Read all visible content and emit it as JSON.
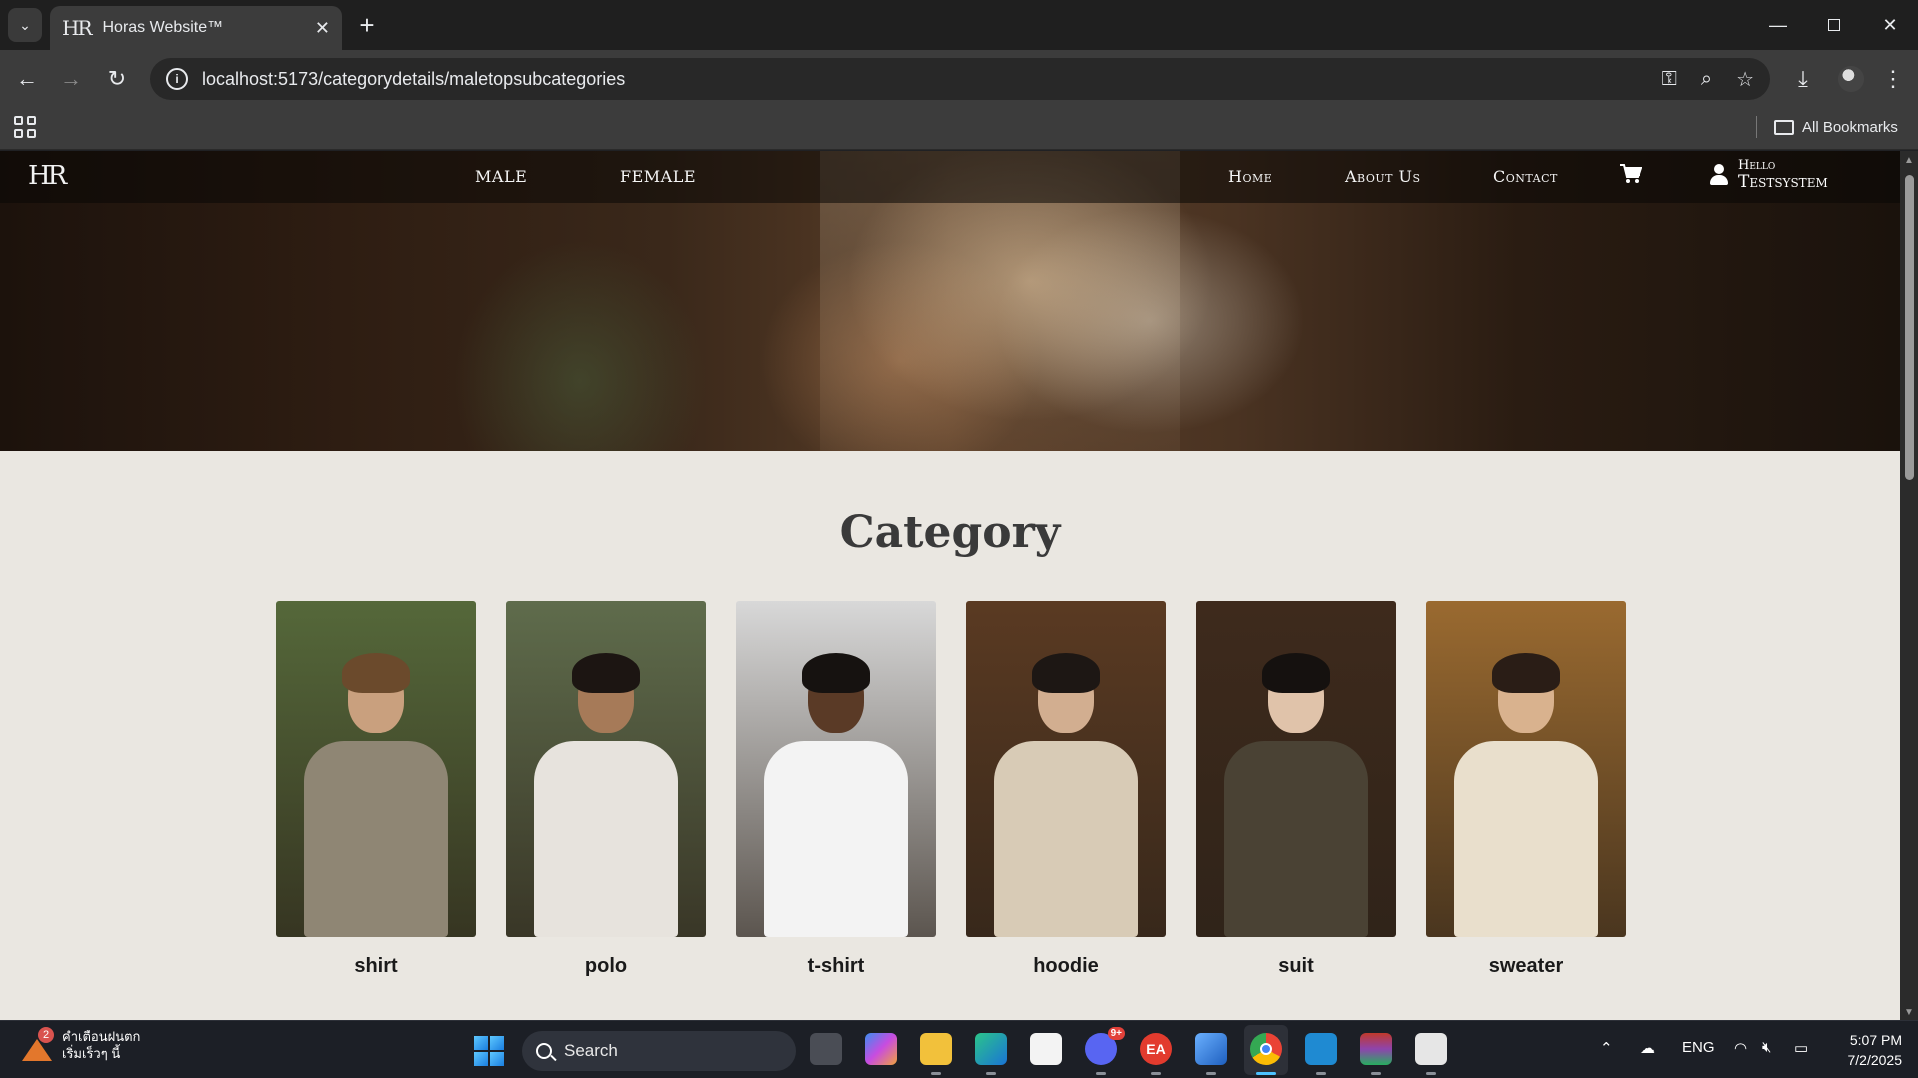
{
  "browser": {
    "tab_title": "Horas Website™",
    "tab_favicon": "HR",
    "url": "localhost:5173/categorydetails/maletopsubcategories",
    "bookmarks_label": "All Bookmarks"
  },
  "site": {
    "logo": "HR",
    "nav_left": [
      "MALE",
      "FEMALE"
    ],
    "nav_right": [
      "Home",
      "About Us",
      "Contact"
    ],
    "user_greeting": "Hello",
    "user_name": "Testsystem"
  },
  "section": {
    "title": "Category"
  },
  "categories": [
    {
      "label": "shirt",
      "bg": "#55683a",
      "shirt": "#8f8674",
      "skin": "#c9a07e",
      "hair": "#6b4a2c"
    },
    {
      "label": "polo",
      "bg": "#5f6c4c",
      "shirt": "#e7e3dd",
      "skin": "#a67a58",
      "hair": "#1c1512"
    },
    {
      "label": "t-shirt",
      "bg": "#d8d8d8",
      "shirt": "#f3f3f3",
      "skin": "#5a3a26",
      "hair": "#161210"
    },
    {
      "label": "hoodie",
      "bg": "#5a3a22",
      "shirt": "#d8cbb6",
      "skin": "#d2ae90",
      "hair": "#1d1714"
    },
    {
      "label": "suit",
      "bg": "#3e2a1c",
      "shirt": "#4a4234",
      "skin": "#e0c3aa",
      "hair": "#15110f"
    },
    {
      "label": "sweater",
      "bg": "#9a6a30",
      "shirt": "#e9dfcc",
      "skin": "#d9b28e",
      "hair": "#2a1d16"
    }
  ],
  "taskbar": {
    "weather_badge": "2",
    "weather_line1": "คำเตือนฝนตก",
    "weather_line2": "เริ่มเร็วๆ นี้",
    "search_placeholder": "Search",
    "discord_badge": "9+",
    "ea_label": "EA",
    "language": "ENG",
    "time": "5:07 PM",
    "date": "7/2/2025"
  }
}
